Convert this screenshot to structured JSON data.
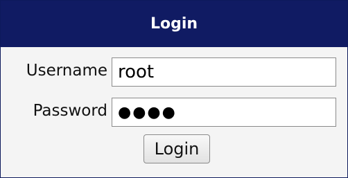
{
  "login": {
    "title": "Login",
    "username_label": "Username",
    "username_value": "root",
    "password_label": "Password",
    "password_value": "●●●●",
    "submit_label": "Login"
  },
  "colors": {
    "header_bg": "#101b63",
    "header_text": "#ffffff",
    "panel_bg": "#f4f4f4"
  }
}
